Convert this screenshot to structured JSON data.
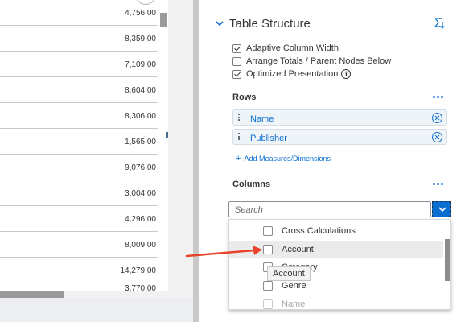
{
  "table": {
    "values": [
      "4,756.00",
      "8,359.00",
      "7,109.00",
      "8,604.00",
      "8,306.00",
      "1,565.00",
      "9,076.00",
      "3,004.00",
      "4,296.00",
      "8,009.00",
      "14,279.00",
      "3,770.00"
    ]
  },
  "panel": {
    "section_title": "Table Structure",
    "options": [
      {
        "label": "Adaptive Column Width",
        "checked": true
      },
      {
        "label": "Arrange Totals / Parent Nodes Below",
        "checked": false
      },
      {
        "label": "Optimized Presentation",
        "checked": true
      }
    ],
    "rows": {
      "title": "Rows",
      "dimensions": [
        "Name",
        "Publisher"
      ],
      "add_link": "Add Measures/Dimensions"
    },
    "columns": {
      "title": "Columns",
      "search_placeholder": "Search",
      "dropdown_items": [
        "Cross Calculations",
        "Account",
        "Category",
        "Genre",
        "Name"
      ]
    },
    "tooltip": "Account"
  },
  "colors": {
    "accent": "#0a6ed1",
    "annotation_arrow": "#e8442a",
    "divider": "#c9c9c9"
  },
  "icons": [
    "chevron-down-icon",
    "sort-icon",
    "info-icon",
    "more-icon",
    "drag-handle-icon",
    "remove-icon",
    "plus-icon",
    "dropdown-chevron-icon"
  ]
}
